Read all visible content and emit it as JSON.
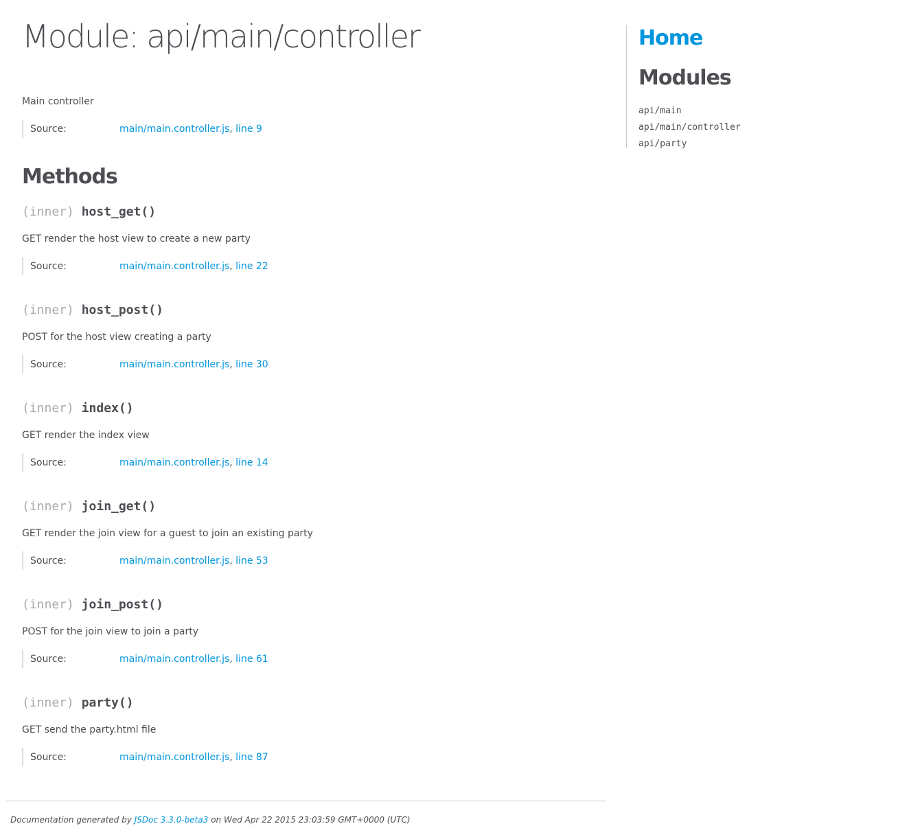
{
  "page": {
    "title": "Module: api/main/controller",
    "description": "Main controller",
    "source": {
      "label": "Source:",
      "file": "main/main.controller.js",
      "separator": ", ",
      "line": "line 9"
    }
  },
  "methods_section": {
    "title": "Methods",
    "items": [
      {
        "attr": "(inner) ",
        "name": "host_get",
        "parens": "()",
        "description": "GET render the host view to create a new party",
        "source": {
          "label": "Source:",
          "file": "main/main.controller.js",
          "separator": ", ",
          "line": "line 22"
        }
      },
      {
        "attr": "(inner) ",
        "name": "host_post",
        "parens": "()",
        "description": "POST for the host view creating a party",
        "source": {
          "label": "Source:",
          "file": "main/main.controller.js",
          "separator": ", ",
          "line": "line 30"
        }
      },
      {
        "attr": "(inner) ",
        "name": "index",
        "parens": "()",
        "description": "GET render the index view",
        "source": {
          "label": "Source:",
          "file": "main/main.controller.js",
          "separator": ", ",
          "line": "line 14"
        }
      },
      {
        "attr": "(inner) ",
        "name": "join_get",
        "parens": "()",
        "description": "GET render the join view for a guest to join an existing party",
        "source": {
          "label": "Source:",
          "file": "main/main.controller.js",
          "separator": ", ",
          "line": "line 53"
        }
      },
      {
        "attr": "(inner) ",
        "name": "join_post",
        "parens": "()",
        "description": "POST for the join view to join a party",
        "source": {
          "label": "Source:",
          "file": "main/main.controller.js",
          "separator": ", ",
          "line": "line 61"
        }
      },
      {
        "attr": "(inner) ",
        "name": "party",
        "parens": "()",
        "description": "GET send the party.html file",
        "source": {
          "label": "Source:",
          "file": "main/main.controller.js",
          "separator": ", ",
          "line": "line 87"
        }
      }
    ]
  },
  "nav": {
    "home": "Home",
    "modules_title": "Modules",
    "modules": [
      "api/main",
      "api/main/controller",
      "api/party"
    ]
  },
  "footer": {
    "prefix": "Documentation generated by ",
    "link": "JSDoc 3.3.0-beta3",
    "suffix": " on Wed Apr 22 2015 23:03:59 GMT+0000 (UTC)"
  },
  "colors": {
    "text": "#4d4e53",
    "link": "#0095dd",
    "muted": "#aaaaaa"
  }
}
